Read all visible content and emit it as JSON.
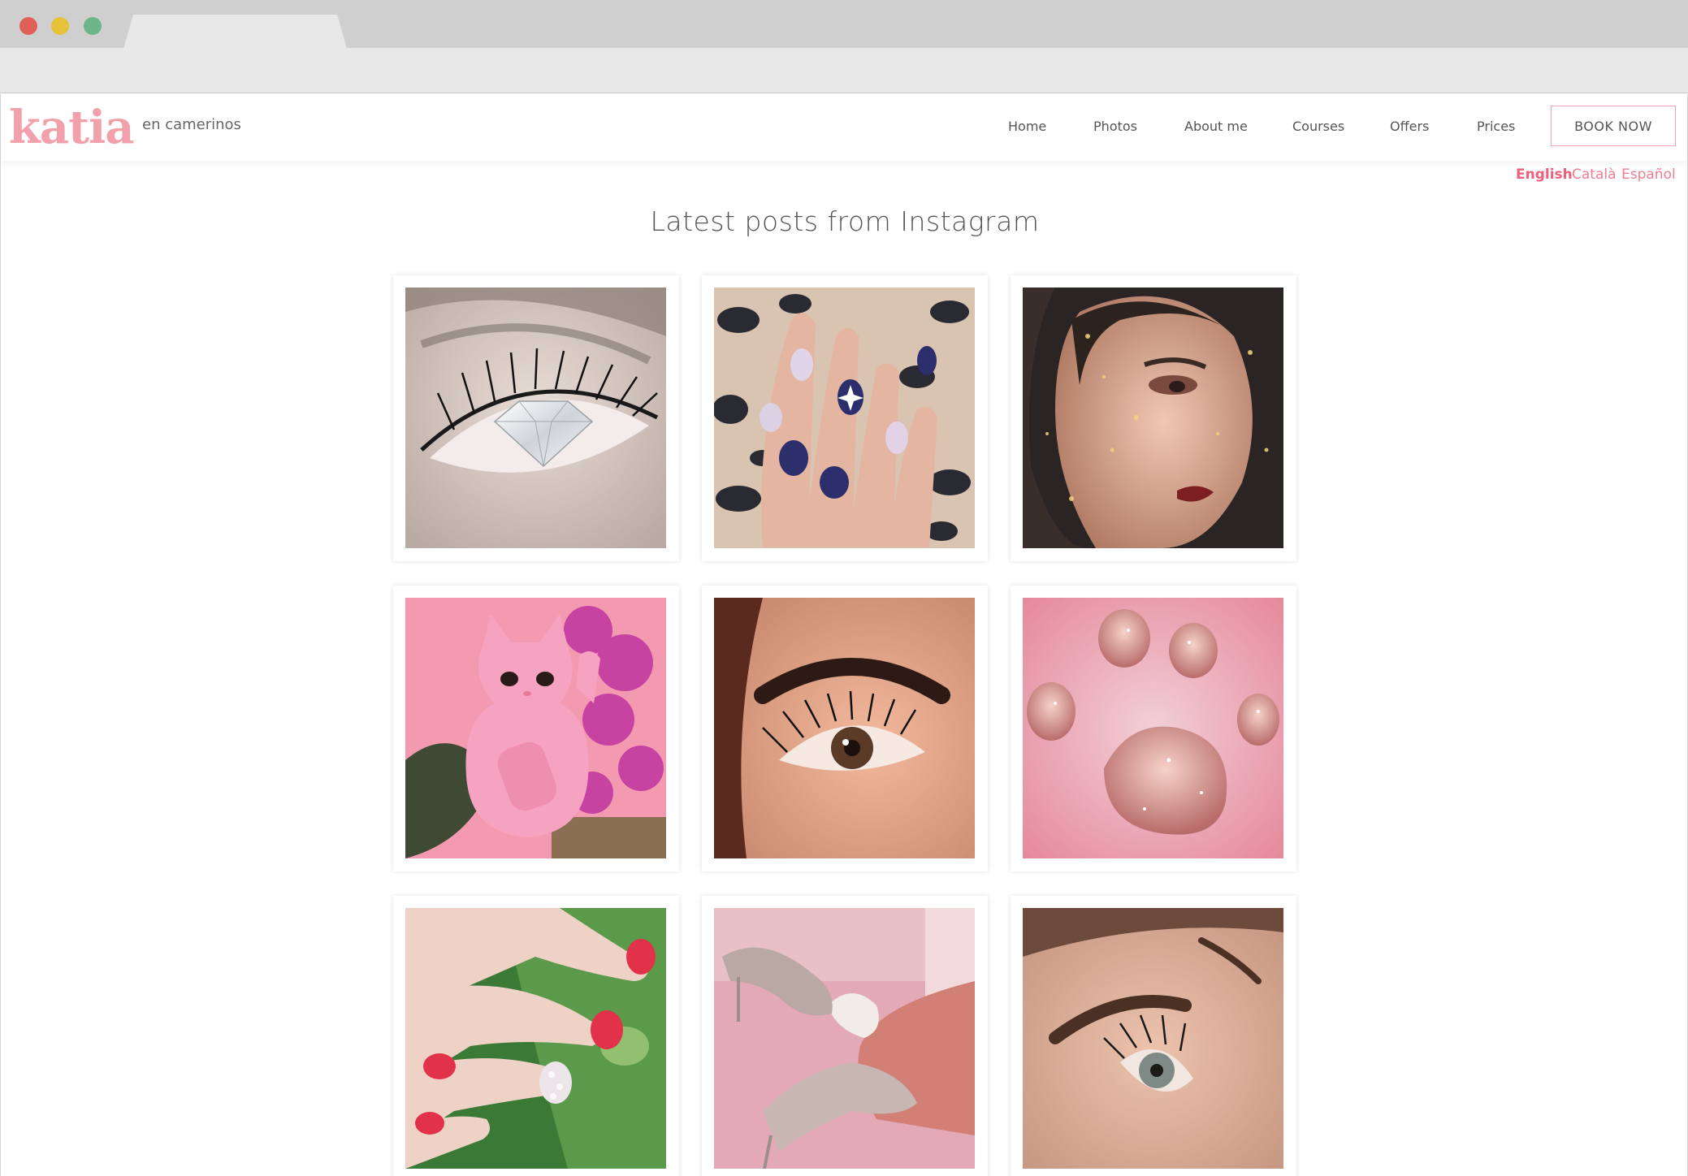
{
  "header": {
    "logo": "katia",
    "tagline": "en camerinos",
    "nav": [
      "Home",
      "Photos",
      "About me",
      "Courses",
      "Offers",
      "Prices"
    ],
    "book_label": "BOOK NOW"
  },
  "languages": [
    "English",
    "Català",
    "Español"
  ],
  "active_language": "English",
  "section": {
    "title": "Latest posts from Instagram"
  },
  "posts": [
    {
      "subject": "eye-with-diamond"
    },
    {
      "subject": "navy-nails-on-leopard"
    },
    {
      "subject": "makeup-portrait-sparkles"
    },
    {
      "subject": "pink-lucky-cat"
    },
    {
      "subject": "eyelash-closeup"
    },
    {
      "subject": "glitter-paw"
    },
    {
      "subject": "red-nails-on-leaf"
    },
    {
      "subject": "glitter-heels"
    },
    {
      "subject": "lash-lift-eye"
    }
  ],
  "colors": {
    "accent": "#f2a0ac",
    "accent_text": "#ee5f79"
  }
}
